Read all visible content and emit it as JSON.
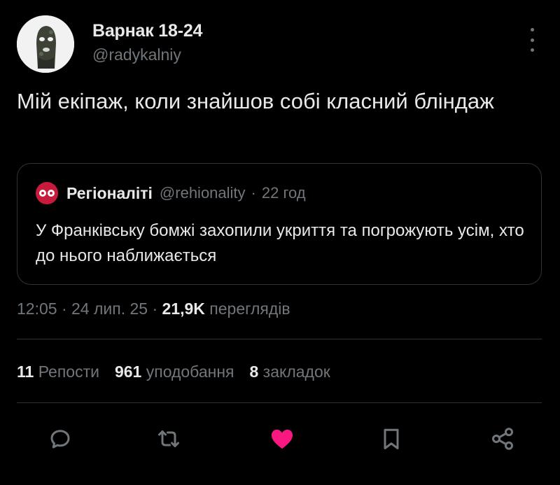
{
  "tweet": {
    "author_name": "Варнак 18-24",
    "author_handle": "@radykalniy",
    "text": "Мій екіпаж, коли знайшов собі класний бліндаж",
    "time": "12:05",
    "date": "24 лип. 25",
    "views_count": "21,9K",
    "views_label": "переглядів"
  },
  "quote": {
    "author_name": "Регіоналіті",
    "author_handle": "@rehionality",
    "time": "22 год",
    "text": "У Франківську бомжі захопили укриття та погрожують усім, хто до нього наближається"
  },
  "stats": {
    "reposts_count": "11",
    "reposts_label": "Репости",
    "likes_count": "961",
    "likes_label": "уподобання",
    "bookmarks_count": "8",
    "bookmarks_label": "закладок"
  },
  "separator": "·",
  "icons": [
    "more-icon",
    "reply-icon",
    "repost-icon",
    "like-icon",
    "bookmark-icon",
    "share-icon"
  ],
  "colors": {
    "background": "#000000",
    "text": "#e7e9ea",
    "muted": "#71767b",
    "like": "#f91880",
    "quote_avatar": "#c81a3c"
  }
}
